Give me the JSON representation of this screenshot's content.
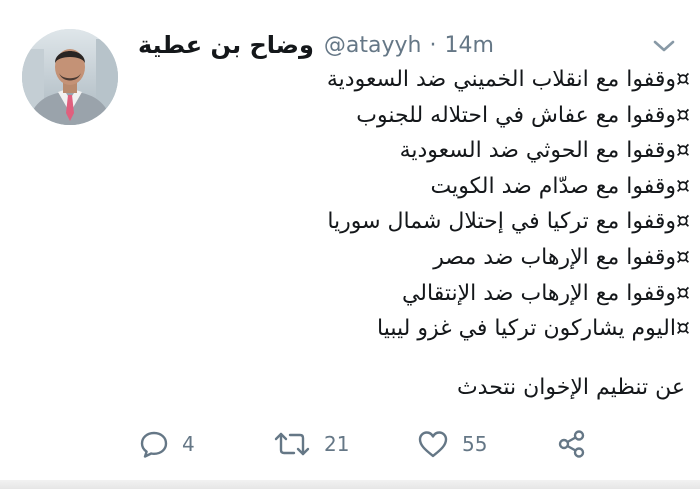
{
  "tweet": {
    "author": {
      "display_name": "وضاح بن عطية",
      "handle": "@atayyh",
      "separator": "·",
      "time_ago": "14m"
    },
    "lines": [
      "¤وقفوا مع انقلاب الخميني ضد السعودية",
      "¤وقفوا مع عفاش في احتلاله للجنوب",
      "¤وقفوا مع الحوثي ضد السعودية",
      "¤وقفوا مع صدّام ضد الكويت",
      "¤وقفوا مع تركيا في إحتلال شمال سوريا",
      "¤وقفوا مع الإرهاب ضد مصر",
      "¤وقفوا مع الإرهاب ضد الإنتقالي",
      "¤اليوم يشاركون تركيا في غزو ليبيا"
    ],
    "closing": "عن تنظيم الإخوان نتحدث",
    "actions": {
      "reply_icon": "reply-icon",
      "reply_count": "4",
      "retweet_icon": "retweet-icon",
      "retweet_count": "21",
      "like_icon": "heart-icon",
      "like_count": "55",
      "share_icon": "share-icon"
    },
    "menu_icon": "chevron-down-icon",
    "colors": {
      "text": "#14171a",
      "muted": "#657786"
    }
  }
}
